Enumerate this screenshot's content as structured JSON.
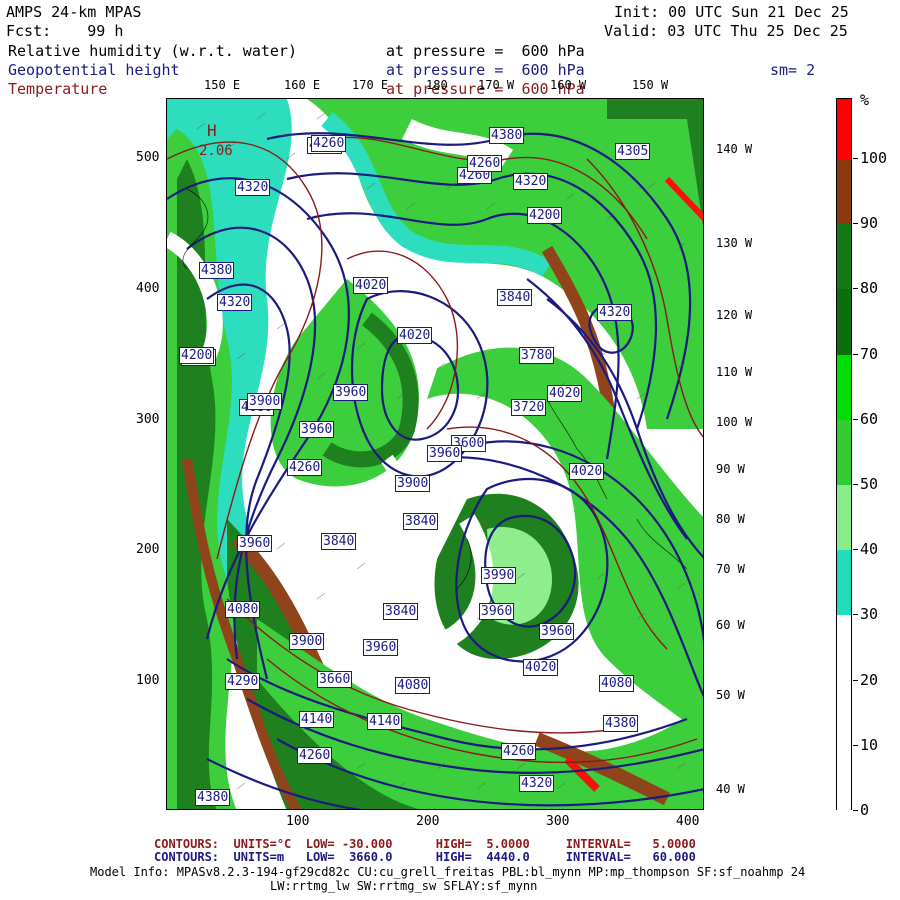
{
  "header": {
    "title": "AMPS 24-km MPAS",
    "fcst": "Fcst:    99 h",
    "init": "Init: 00 UTC Sun 21 Dec 25",
    "valid": "Valid: 03 UTC Thu 25 Dec 25",
    "var1": "Relative humidity (w.r.t. water)",
    "var2": "Geopotential height",
    "var3": "Temperature",
    "press1": "at pressure =  600 hPa",
    "press2": "at pressure =  600 hPa",
    "press3": "at pressure =  600 hPa",
    "smoothing": "sm= 2",
    "colors": {
      "rh_label": "#000000",
      "height": "#1a1a80",
      "temperature": "#8b1a1a"
    }
  },
  "axes": {
    "y_ticks": [
      "500",
      "400",
      "300",
      "200",
      "100"
    ],
    "x_ticks": [
      "100",
      "200",
      "300",
      "400"
    ],
    "top_lon": [
      "150 E",
      "160 E",
      "170 E",
      "180",
      "170 W",
      "160 W",
      "150 W"
    ],
    "right_lon": [
      "140 W",
      "130 W",
      "120 W",
      "110 W",
      "100 W",
      "90 W",
      "80 W",
      "70 W",
      "60 W",
      "50 W",
      "40 W"
    ]
  },
  "colorbar": {
    "unit": "%",
    "labels": [
      "100",
      "90",
      "80",
      "70",
      "60",
      "50",
      "40",
      "30",
      "20",
      "10",
      "0"
    ],
    "segments": [
      {
        "range": "100+",
        "color": "#ff0000"
      },
      {
        "range": "90-100",
        "color": "#8b3a0f"
      },
      {
        "range": "80-90",
        "color": "#137a13"
      },
      {
        "range": "70-80",
        "color": "#0a6e0a"
      },
      {
        "range": "60-70",
        "color": "#00dd00"
      },
      {
        "range": "50-60",
        "color": "#33cc33"
      },
      {
        "range": "40-50",
        "color": "#88ee88"
      },
      {
        "range": "30-40",
        "color": "#22ddbb"
      },
      {
        "range": "20-30",
        "color": "#ffffff"
      },
      {
        "range": "10-20",
        "color": "#ffffff"
      },
      {
        "range": "0-10",
        "color": "#ffffff"
      }
    ]
  },
  "map_labels": {
    "height_labels": [
      "4320",
      "4380",
      "4260",
      "4320",
      "4380",
      "4305",
      "4320",
      "4320",
      "4260",
      "4200",
      "4380",
      "4020",
      "3840",
      "4320",
      "4020",
      "3960",
      "4260",
      "4200",
      "4080",
      "3960",
      "3660",
      "4020",
      "3780",
      "3900",
      "3720",
      "3900",
      "3840",
      "4260",
      "3600",
      "3840",
      "4020",
      "3960",
      "3900",
      "3840",
      "3960",
      "3960",
      "3990",
      "4080",
      "3960",
      "4290",
      "3960",
      "4020",
      "4080",
      "4140",
      "4140",
      "4080",
      "4380",
      "4260",
      "4260",
      "4320",
      "4380"
    ],
    "high": "H",
    "high_value": "2.06"
  },
  "footer": {
    "line1_label": "CONTOURS:  UNITS=°C  LOW= -30.000      HIGH=  5.0000     INTERVAL=   5.0000",
    "line2_label": "CONTOURS:  UNITS=m   LOW=  3660.0      HIGH=  4440.0     INTERVAL=   60.000",
    "model_info": "Model Info: MPASv8.2.3-194-gf29cd82c CU:cu_grell_freitas PBL:bl_mynn MP:mp_thompson SF:sf_noahmp 24",
    "model_info2": "LW:rrtmg_lw SW:rrtmg_sw SFLAY:sf_mynn"
  }
}
